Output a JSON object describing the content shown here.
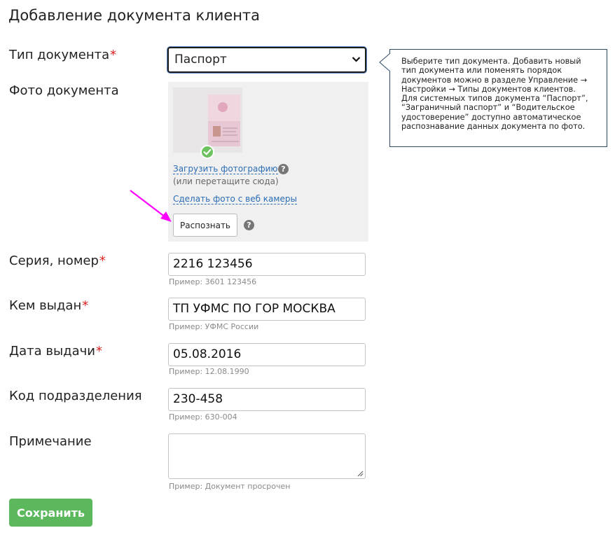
{
  "page_title": "Добавление документа клиента",
  "required_mark": "*",
  "fields": {
    "doc_type": {
      "label": "Тип документа",
      "value": "Паспорт"
    },
    "photo": {
      "label": "Фото документа",
      "upload_link": "Загрузить фотографию",
      "drag_hint": "(или перетащите сюда)",
      "webcam_link": "Сделать фото с веб камеры",
      "recognize_button": "Распознать"
    },
    "series_number": {
      "label": "Серия, номер",
      "value": "2216 123456",
      "hint": "Пример: 3601 123456"
    },
    "issued_by": {
      "label": "Кем выдан",
      "value": "ТП УФМС ПО ГОР МОСКВА",
      "hint": "Пример: УФМС России"
    },
    "issue_date": {
      "label": "Дата выдачи",
      "value": "05.08.2016",
      "hint": "Пример: 12.08.1990"
    },
    "dept_code": {
      "label": "Код подразделения",
      "value": "230-458",
      "hint": "Пример: 630-004"
    },
    "note": {
      "label": "Примечание",
      "value": "",
      "hint": "Пример: Документ просрочен"
    }
  },
  "tooltip": {
    "lines": [
      "Выберите тип документа. Добавить новый",
      "тип документа или поменять порядок",
      "документов можно в разделе Управление →",
      "Настройки → Типы документов клиентов.",
      "Для системных типов документа “Паспорт”,",
      "“Заграничный паспорт” и “Водительское",
      "удостоверение” доступно автоматическое",
      "распознавание данных документа по фото."
    ]
  },
  "help_glyph": "?",
  "save_button": "Сохранить",
  "colors": {
    "required": "#d62020",
    "link": "#2a6db6",
    "save_button": "#5cb85c",
    "check": "#6cc25d",
    "annotation_arrow": "#ff00ff"
  },
  "icons": [
    "chevron-down-icon",
    "check-icon",
    "help-icon",
    "resize-grip-icon",
    "annotation-arrow-icon"
  ]
}
